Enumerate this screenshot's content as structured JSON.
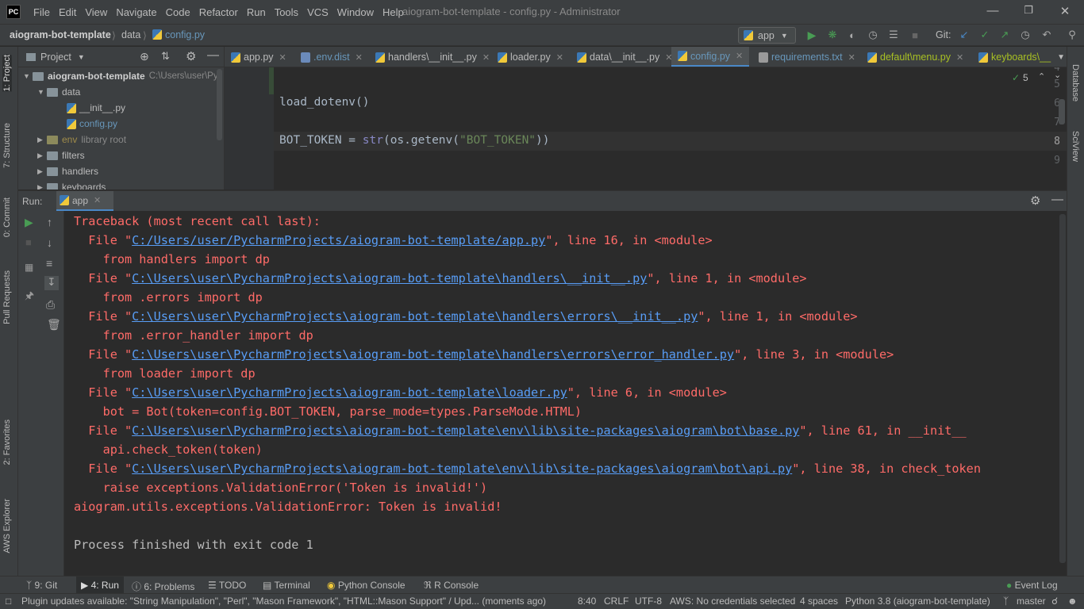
{
  "menubar": {
    "logo": "PC",
    "items": [
      "File",
      "Edit",
      "View",
      "Navigate",
      "Code",
      "Refactor",
      "Run",
      "Tools",
      "VCS",
      "Window",
      "Help"
    ],
    "window_title": "aiogram-bot-template - config.py - Administrator"
  },
  "navbar": {
    "project": "aiogram-bot-template",
    "folder": "data",
    "file": "config.py",
    "run_config": "app",
    "git_label": "Git:"
  },
  "project_panel": {
    "title": "Project",
    "tree": [
      {
        "label": "aiogram-bot-template",
        "hint": "C:\\Users\\user\\Py"
      },
      {
        "label": "data"
      },
      {
        "label": "__init__.py"
      },
      {
        "label": "config.py"
      },
      {
        "label": "env",
        "hint": "library root"
      },
      {
        "label": "filters"
      },
      {
        "label": "handlers"
      },
      {
        "label": "keyboards"
      }
    ]
  },
  "left_stripe": [
    "1: Project",
    "7: Structure",
    "0: Commit",
    "Pull Requests",
    "2: Favorites",
    "AWS Explorer"
  ],
  "right_stripe": [
    "Database",
    "SciView"
  ],
  "editor": {
    "tabs": [
      "app.py",
      ".env.dist",
      "handlers\\__init__.py",
      "loader.py",
      "data\\__init__.py",
      "config.py",
      "requirements.txt",
      "default\\menu.py",
      "keyboards\\__"
    ],
    "active_tab": "config.py",
    "inspection_count": "5",
    "lines": [
      {
        "num": "4",
        "code": ""
      },
      {
        "num": "5",
        "code": ""
      },
      {
        "num": "6",
        "code": "load_dotenv()"
      },
      {
        "num": "7",
        "code": ""
      },
      {
        "num": "8",
        "code": "BOT_TOKEN = str(os.getenv(\"BOT_TOKEN\"))"
      },
      {
        "num": "9",
        "code": ""
      }
    ]
  },
  "run_panel": {
    "label": "Run:",
    "tab": "app",
    "console": [
      {
        "pre": "Traceback (most recent call last):",
        "link": "",
        "post": ""
      },
      {
        "pre": "  File \"",
        "link": "C:/Users/user/PycharmProjects/aiogram-bot-template/app.py",
        "post": "\", line 16, in <module>"
      },
      {
        "pre": "    from handlers import dp",
        "link": "",
        "post": ""
      },
      {
        "pre": "  File \"",
        "link": "C:\\Users\\user\\PycharmProjects\\aiogram-bot-template\\handlers\\__init__.py",
        "post": "\", line 1, in <module>"
      },
      {
        "pre": "    from .errors import dp",
        "link": "",
        "post": ""
      },
      {
        "pre": "  File \"",
        "link": "C:\\Users\\user\\PycharmProjects\\aiogram-bot-template\\handlers\\errors\\__init__.py",
        "post": "\", line 1, in <module>"
      },
      {
        "pre": "    from .error_handler import dp",
        "link": "",
        "post": ""
      },
      {
        "pre": "  File \"",
        "link": "C:\\Users\\user\\PycharmProjects\\aiogram-bot-template\\handlers\\errors\\error_handler.py",
        "post": "\", line 3, in <module>"
      },
      {
        "pre": "    from loader import dp",
        "link": "",
        "post": ""
      },
      {
        "pre": "  File \"",
        "link": "C:\\Users\\user\\PycharmProjects\\aiogram-bot-template\\loader.py",
        "post": "\", line 6, in <module>"
      },
      {
        "pre": "    bot = Bot(token=config.BOT_TOKEN, parse_mode=types.ParseMode.HTML)",
        "link": "",
        "post": ""
      },
      {
        "pre": "  File \"",
        "link": "C:\\Users\\user\\PycharmProjects\\aiogram-bot-template\\env\\lib\\site-packages\\aiogram\\bot\\base.py",
        "post": "\", line 61, in __init__"
      },
      {
        "pre": "    api.check_token(token)",
        "link": "",
        "post": ""
      },
      {
        "pre": "  File \"",
        "link": "C:\\Users\\user\\PycharmProjects\\aiogram-bot-template\\env\\lib\\site-packages\\aiogram\\bot\\api.py",
        "post": "\", line 38, in check_token"
      },
      {
        "pre": "    raise exceptions.ValidationError('Token is invalid!')",
        "link": "",
        "post": ""
      },
      {
        "pre": "aiogram.utils.exceptions.ValidationError: Token is invalid!",
        "link": "",
        "post": ""
      },
      {
        "pre": "",
        "link": "",
        "post": ""
      },
      {
        "pre": "Process finished with exit code 1",
        "link": "",
        "post": ""
      }
    ]
  },
  "bottom_tools": {
    "git": "9: Git",
    "run": "4: Run",
    "problems": "6: Problems",
    "todo": "TODO",
    "terminal": "Terminal",
    "python_console": "Python Console",
    "r_console": "R Console",
    "event_log": "Event Log"
  },
  "statusbar": {
    "message": "Plugin updates available: \"String Manipulation\", \"Perl\", \"Mason Framework\", \"HTML::Mason Support\" / Upd... (moments ago)",
    "position": "8:40",
    "line_sep": "CRLF",
    "encoding": "UTF-8",
    "aws": "AWS: No credentials selected",
    "indent": "4 spaces",
    "interpreter": "Python 3.8 (aiogram-bot-template)",
    "branch": "master"
  },
  "colors": {
    "error": "#ff6b68",
    "link": "#589df6",
    "accent": "#4a88c7",
    "run_green": "#499c54"
  }
}
